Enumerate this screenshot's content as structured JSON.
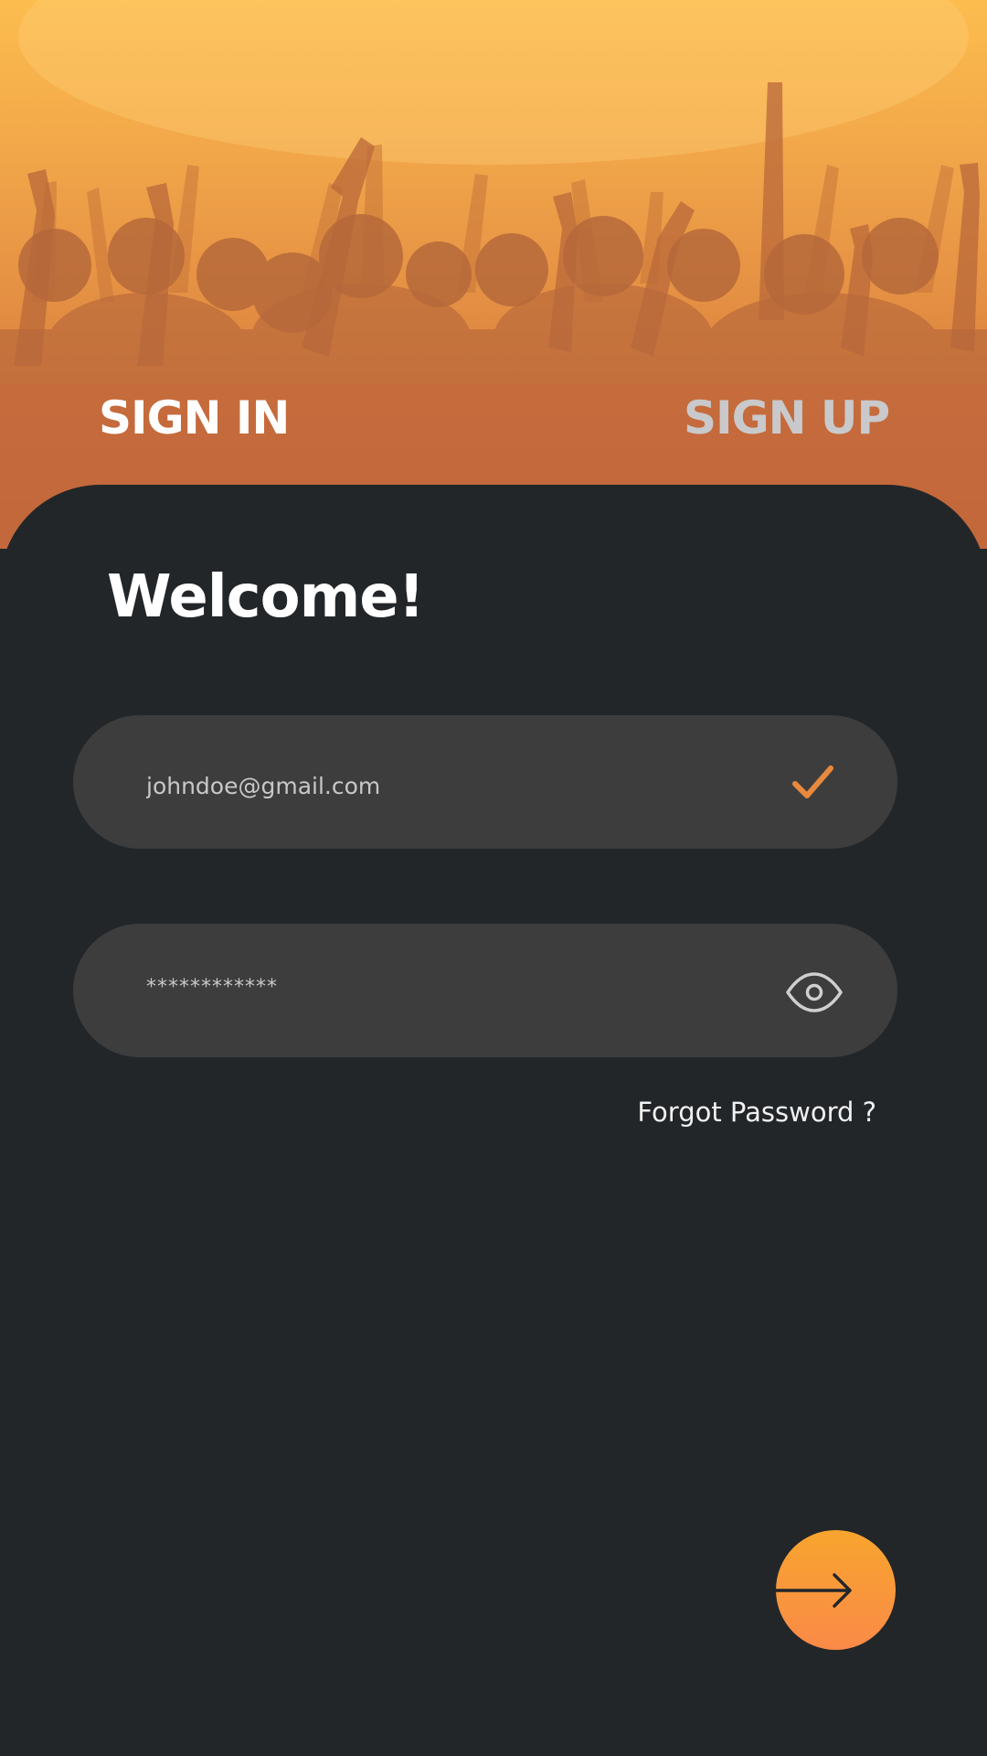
{
  "hero": {
    "image_desc": "concert-crowd-background",
    "tabs": [
      {
        "label": "SIGN IN",
        "active": true
      },
      {
        "label": "SIGN UP",
        "active": false
      }
    ]
  },
  "form": {
    "title": "Welcome!",
    "email": {
      "value": "johndoe@gmail.com",
      "status_icon": "check-icon"
    },
    "password": {
      "value": "************",
      "toggle_icon": "eye-icon"
    },
    "forgot_label": "Forgot Password ?",
    "submit_icon": "arrow-right-icon"
  },
  "colors": {
    "accent": "#e8893d",
    "background": "#232629",
    "field": "#3d3d3d",
    "button_top": "#f8a52e",
    "button_bottom": "#fa8a48",
    "inactive_tab": "#c9c9cb"
  }
}
